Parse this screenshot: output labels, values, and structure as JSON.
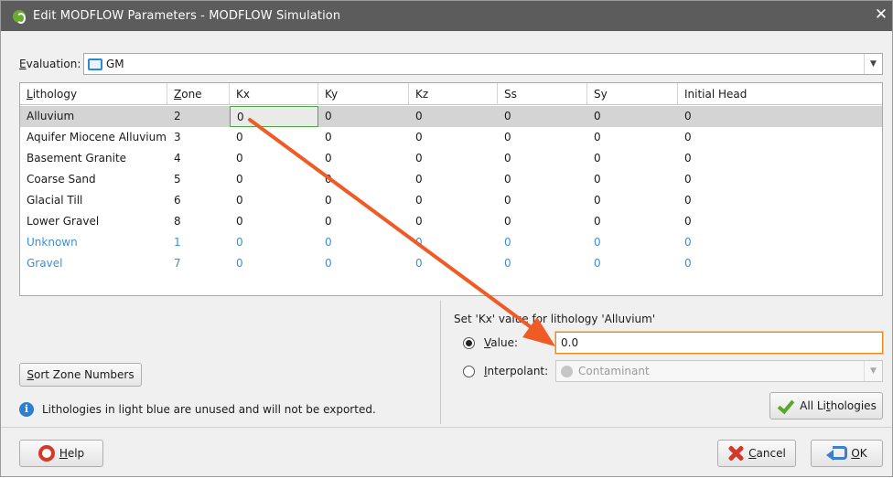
{
  "window": {
    "title": "Edit MODFLOW Parameters - MODFLOW Simulation",
    "close_glyph": "✕"
  },
  "evaluation": {
    "label_first": "E",
    "label_rest": "valuation:",
    "value": "GM",
    "icon": "mesh-icon"
  },
  "grid": {
    "headers": [
      {
        "first": "L",
        "rest": "ithology"
      },
      {
        "first": "Z",
        "rest": "one"
      },
      {
        "first": "",
        "rest": "Kx"
      },
      {
        "first": "",
        "rest": "Ky"
      },
      {
        "first": "",
        "rest": "Kz"
      },
      {
        "first": "",
        "rest": "Ss"
      },
      {
        "first": "",
        "rest": "Sy"
      },
      {
        "first": "",
        "rest": "Initial Head"
      }
    ],
    "rows": [
      [
        "Alluvium",
        "2",
        "0",
        "0",
        "0",
        "0",
        "0",
        "0"
      ],
      [
        "Aquifer Miocene Alluvium",
        "3",
        "0",
        "0",
        "0",
        "0",
        "0",
        "0"
      ],
      [
        "Basement Granite",
        "4",
        "0",
        "0",
        "0",
        "0",
        "0",
        "0"
      ],
      [
        "Coarse Sand",
        "5",
        "0",
        "0",
        "0",
        "0",
        "0",
        "0"
      ],
      [
        "Glacial Till",
        "6",
        "0",
        "0",
        "0",
        "0",
        "0",
        "0"
      ],
      [
        "Lower Gravel",
        "8",
        "0",
        "0",
        "0",
        "0",
        "0",
        "0"
      ],
      [
        "Unknown",
        "1",
        "0",
        "0",
        "0",
        "0",
        "0",
        "0"
      ],
      [
        "Gravel",
        "7",
        "0",
        "0",
        "0",
        "0",
        "0",
        "0"
      ]
    ]
  },
  "sort_button": {
    "first": "S",
    "rest": "ort Zone Numbers"
  },
  "info": {
    "icon": "info-icon",
    "glyph": "i",
    "text": "Lithologies in light blue are unused and will not be exported."
  },
  "set_value": {
    "label": "Set 'Kx' value for lithology 'Alluvium'",
    "value_radio": {
      "first": "V",
      "rest": "alue:"
    },
    "value_input": "0.0",
    "interp_radio": {
      "first": "I",
      "rest": "nterpolant:"
    },
    "interp_value": "Contaminant"
  },
  "all_lithologies_button": {
    "pre": "All Li",
    "u": "t",
    "post": "hologies"
  },
  "help_button": {
    "first": "H",
    "rest": "elp"
  },
  "cancel_button": {
    "first": "C",
    "rest": "ancel"
  },
  "ok_button": {
    "first": "O",
    "rest": "K"
  },
  "colors": {
    "unused_lithology": "#3d8fd4",
    "title_bar": "#5c5c5c",
    "focus": "#e8891c",
    "annotation_arrow": "#f05a24"
  }
}
